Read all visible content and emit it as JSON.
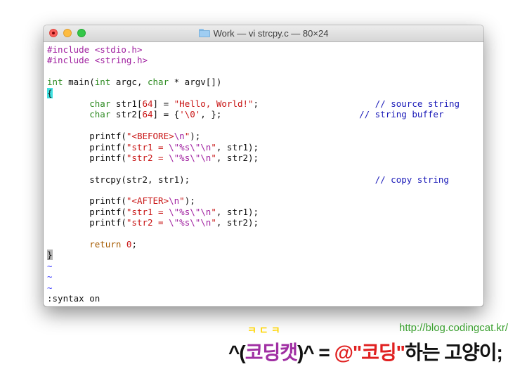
{
  "window": {
    "title": "Work — vi strcpy.c — 80×24",
    "icons": {
      "close": "close-button",
      "minimize": "minimize-button",
      "zoom": "zoom-button",
      "folder": "folder-icon"
    }
  },
  "code": {
    "l1a": "#include ",
    "l1b": "<stdio.h>",
    "l2a": "#include ",
    "l2b": "<string.h>",
    "l4a": "int",
    "l4b": " main(",
    "l4c": "int",
    "l4d": " argc, ",
    "l4e": "char",
    "l4f": " * argv[])",
    "l5": "{",
    "l6a": "        ",
    "l6b": "char",
    "l6c": " str1[",
    "l6d": "64",
    "l6e": "] = ",
    "l6f": "\"Hello, World!\"",
    "l6g": ";                      ",
    "l6h": "// source string",
    "l7a": "        ",
    "l7b": "char",
    "l7c": " str2[",
    "l7d": "64",
    "l7e": "] = {",
    "l7f": "'\\0'",
    "l7g": ", };                          ",
    "l7h": "// string buffer",
    "l9a": "        printf(",
    "l9b": "\"<BEFORE>",
    "l9c": "\\n",
    "l9d": "\"",
    "l9e": ");",
    "l10a": "        printf(",
    "l10b": "\"str1 = ",
    "l10c": "\\\"",
    "l10d": "%s",
    "l10e": "\\\"\\n",
    "l10f": "\"",
    "l10g": ", str1);",
    "l11a": "        printf(",
    "l11b": "\"str2 = ",
    "l11c": "\\\"",
    "l11d": "%s",
    "l11e": "\\\"\\n",
    "l11f": "\"",
    "l11g": ", str2);",
    "l13a": "        strcpy(str2, str1);                                   ",
    "l13b": "// copy string",
    "l15a": "        printf(",
    "l15b": "\"<AFTER>",
    "l15c": "\\n",
    "l15d": "\"",
    "l15e": ");",
    "l16a": "        printf(",
    "l16b": "\"str1 = ",
    "l16c": "\\\"",
    "l16d": "%s",
    "l16e": "\\\"\\n",
    "l16f": "\"",
    "l16g": ", str1);",
    "l17a": "        printf(",
    "l17b": "\"str2 = ",
    "l17c": "\\\"",
    "l17d": "%s",
    "l17e": "\\\"\\n",
    "l17f": "\"",
    "l17g": ", str2);",
    "l19a": "        ",
    "l19b": "return",
    "l19c": " ",
    "l19d": "0",
    "l19e": ";",
    "l20": "}",
    "tilde": "~"
  },
  "command_line": ":syntax on",
  "watermark": {
    "small": "ㅋㄷㅋ",
    "url": "http://blog.codingcat.kr/",
    "m1": "^(",
    "m2": "코딩캣",
    "m3": ")^ = ",
    "m4": "@\"코딩\"",
    "m5": "하는 고양이;"
  }
}
